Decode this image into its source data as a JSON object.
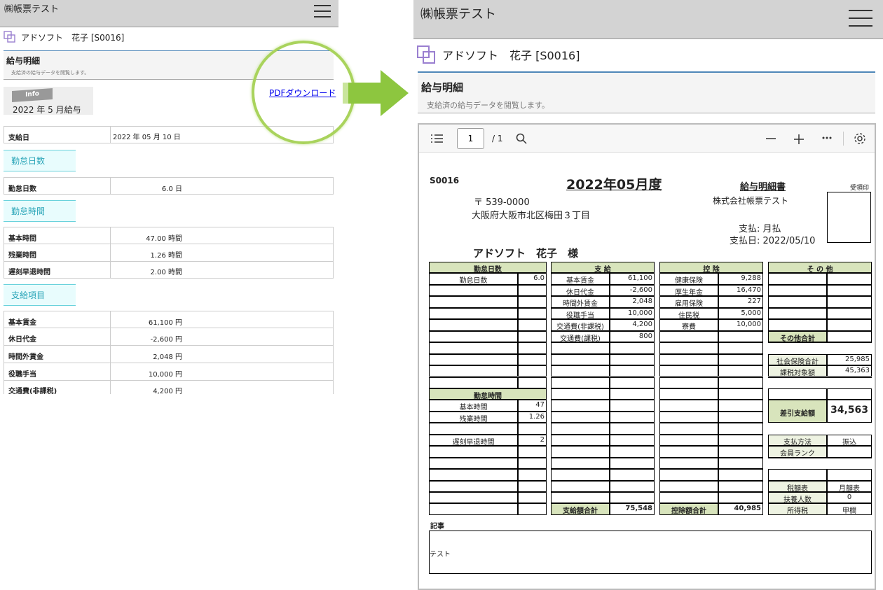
{
  "left": {
    "app_title": "㈱帳票テスト",
    "user_name": "アドソフト　花子 [S0016]",
    "page_title": "給与明細",
    "page_subtitle": "支給済の給与データを閲覧します。",
    "info_badge": "Info",
    "period": "2022 年 5 月給与",
    "pdf_link": "PDFダウンロード",
    "pay_date": {
      "label": "支給日",
      "value": "2022 年 05 月 10 日"
    },
    "sec_attendance_days": "勤怠日数",
    "attendance_days": [
      {
        "label": "勤怠日数",
        "value": "6.0 日"
      }
    ],
    "sec_attendance_time": "勤怠時間",
    "attendance_time": [
      {
        "label": "基本時間",
        "value": "47.00 時間"
      },
      {
        "label": "残業時間",
        "value": "1.26 時間"
      },
      {
        "label": "遅刻早退時間",
        "value": "2.00 時間"
      }
    ],
    "sec_payments": "支給項目",
    "payments": [
      {
        "label": "基本賃金",
        "value": "61,100 円"
      },
      {
        "label": "休日代金",
        "value": "-2,600 円"
      },
      {
        "label": "時間外賃金",
        "value": "2,048 円"
      },
      {
        "label": "役職手当",
        "value": "10,000 円"
      },
      {
        "label": "交通費(非課税)",
        "value": "4,200 円"
      }
    ]
  },
  "right": {
    "app_title": "㈱帳票テスト",
    "user_name": "アドソフト　花子 [S0016]",
    "page_title": "給与明細",
    "page_subtitle": "支給済の給与データを閲覧します。",
    "viewer": {
      "page_value": "1",
      "page_total": "/ 1"
    },
    "doc": {
      "employee_code": "S0016",
      "month_title": "2022年05月度",
      "doc_title": "給与明細書",
      "stamp_label": "受領印",
      "postal": "〒 539-0000",
      "address": "大阪府大阪市北区梅田３丁目",
      "company": "株式会社帳票テスト",
      "pay_type": "支払: 月払",
      "pay_date": "支払日: 2022/05/10",
      "addressee": "アドソフト　花子　様",
      "h_att_days": "勤怠日数",
      "att_days": [
        {
          "label": "勤怠日数",
          "value": "6.0"
        }
      ],
      "h_att_time": "勤怠時間",
      "att_time": [
        {
          "label": "基本時間",
          "value": "47"
        },
        {
          "label": "残業時間",
          "value": "1.26"
        },
        {
          "label": "",
          "value": ""
        },
        {
          "label": "遅刻早退時間",
          "value": "2"
        }
      ],
      "h_pay": "支 給",
      "pay": [
        {
          "label": "基本賃金",
          "value": "61,100"
        },
        {
          "label": "休日代金",
          "value": "-2,600"
        },
        {
          "label": "時間外賃金",
          "value": "2,048"
        },
        {
          "label": "役職手当",
          "value": "10,000"
        },
        {
          "label": "交通費(非課税)",
          "value": "4,200"
        },
        {
          "label": "交通費(課税)",
          "value": "800"
        }
      ],
      "pay_total_label": "支給額合計",
      "pay_total": "75,548",
      "h_ded": "控 除",
      "ded": [
        {
          "label": "健康保険",
          "value": "9,288"
        },
        {
          "label": "厚生年金",
          "value": "16,470"
        },
        {
          "label": "雇用保険",
          "value": "227"
        },
        {
          "label": "住民税",
          "value": "5,000"
        },
        {
          "label": "寮費",
          "value": "10,000"
        }
      ],
      "ded_total_label": "控除額合計",
      "ded_total": "40,985",
      "h_other": "そ の 他",
      "other_total_label": "その他合計",
      "social_ins_label": "社会保険合計",
      "social_ins": "25,985",
      "taxable_label": "課税対象額",
      "taxable": "45,363",
      "net_label": "差引支給額",
      "net": "34,563",
      "pay_method_label": "支払方法",
      "pay_method": "振込",
      "member_rank_label": "会員ランク",
      "member_rank": "",
      "tax_table_label": "税額表",
      "tax_table": "月額表",
      "dependents_label": "扶養人数",
      "dependents": "0",
      "income_tax_label": "所得税",
      "income_tax": "甲欄",
      "memo_label": "記事",
      "memo": "テスト"
    }
  },
  "colors": {
    "header_bg": "#d3d3d3",
    "section_bg": "#e8fcfd",
    "section_text": "#2aa5b8",
    "table_header": "#d8e4bc",
    "arrow": "#8dc63f",
    "link": "#0000ee"
  }
}
